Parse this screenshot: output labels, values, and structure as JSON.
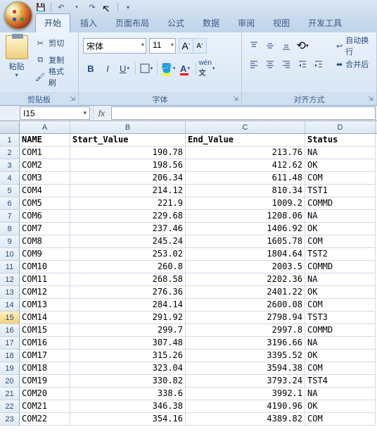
{
  "qat": {
    "save": "save",
    "undo": "undo",
    "redo": "redo"
  },
  "tabs": [
    "开始",
    "插入",
    "页面布局",
    "公式",
    "数据",
    "审阅",
    "视图",
    "开发工具"
  ],
  "active_tab": 0,
  "clipboard": {
    "paste": "粘贴",
    "cut": "剪切",
    "copy": "复制",
    "format_painter": "格式刷",
    "group": "剪贴板"
  },
  "font": {
    "name": "宋体",
    "size": "11",
    "group": "字体"
  },
  "align": {
    "wrap": "自动换行",
    "merge": "合并后",
    "group": "对齐方式"
  },
  "namebox": "I15",
  "headers": [
    "A",
    "B",
    "C",
    "D"
  ],
  "sheet": {
    "cols": [
      "NAME",
      "Start_Value",
      "End_Value",
      "Status"
    ],
    "rows": [
      {
        "n": "COM1",
        "s": "190.78",
        "e": "213.76",
        "st": "NA"
      },
      {
        "n": "COM2",
        "s": "198.56",
        "e": "412.62",
        "st": "OK"
      },
      {
        "n": "COM3",
        "s": "206.34",
        "e": "611.48",
        "st": "COM"
      },
      {
        "n": "COM4",
        "s": "214.12",
        "e": "810.34",
        "st": "TST1"
      },
      {
        "n": "COM5",
        "s": "221.9",
        "e": "1009.2",
        "st": "COMMD"
      },
      {
        "n": "COM6",
        "s": "229.68",
        "e": "1208.06",
        "st": "NA"
      },
      {
        "n": "COM7",
        "s": "237.46",
        "e": "1406.92",
        "st": "OK"
      },
      {
        "n": "COM8",
        "s": "245.24",
        "e": "1605.78",
        "st": "COM"
      },
      {
        "n": "COM9",
        "s": "253.02",
        "e": "1804.64",
        "st": "TST2"
      },
      {
        "n": "COM10",
        "s": "260.8",
        "e": "2003.5",
        "st": "COMMD"
      },
      {
        "n": "COM11",
        "s": "268.58",
        "e": "2202.36",
        "st": "NA"
      },
      {
        "n": "COM12",
        "s": "276.36",
        "e": "2401.22",
        "st": "OK"
      },
      {
        "n": "COM13",
        "s": "284.14",
        "e": "2600.08",
        "st": "COM"
      },
      {
        "n": "COM14",
        "s": "291.92",
        "e": "2798.94",
        "st": "TST3"
      },
      {
        "n": "COM15",
        "s": "299.7",
        "e": "2997.8",
        "st": "COMMD"
      },
      {
        "n": "COM16",
        "s": "307.48",
        "e": "3196.66",
        "st": "NA"
      },
      {
        "n": "COM17",
        "s": "315.26",
        "e": "3395.52",
        "st": "OK"
      },
      {
        "n": "COM18",
        "s": "323.04",
        "e": "3594.38",
        "st": "COM"
      },
      {
        "n": "COM19",
        "s": "330.82",
        "e": "3793.24",
        "st": "TST4"
      },
      {
        "n": "COM20",
        "s": "338.6",
        "e": "3992.1",
        "st": "NA"
      },
      {
        "n": "COM21",
        "s": "346.38",
        "e": "4190.96",
        "st": "OK"
      },
      {
        "n": "COM22",
        "s": "354.16",
        "e": "4389.82",
        "st": "COM"
      }
    ]
  },
  "selected_row": 15
}
